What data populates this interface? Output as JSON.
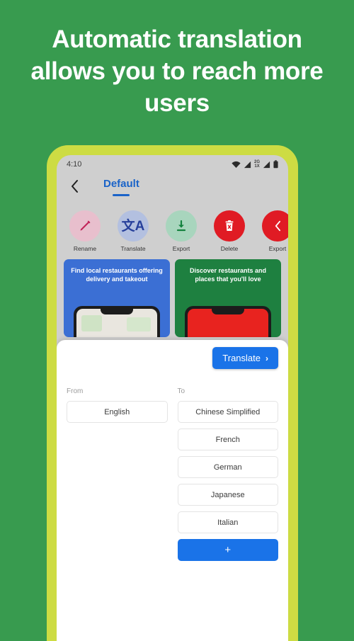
{
  "headline": "Automatic translation allows you to reach more users",
  "colors": {
    "background": "#389b4f",
    "bezel": "#cddc43",
    "screen": "#cfcfcf",
    "accent_blue": "#1a73e8",
    "tab_blue": "#1a63c8",
    "delete_red": "#e01b24"
  },
  "phone": {
    "statusbar": {
      "time": "4:10",
      "data_top": "2G",
      "data_bottom": "1X",
      "icons": [
        "wifi-icon",
        "signal-icon",
        "data-indicator-icon",
        "battery-icon"
      ]
    },
    "appbar": {
      "back_icon": "chevron-left-icon",
      "tab_label": "Default"
    },
    "actions": [
      {
        "label": "Rename",
        "icon": "pencil-icon",
        "circle": "#e8bfcd",
        "fg": "#c2245a"
      },
      {
        "label": "Translate",
        "icon": "translate-icon",
        "circle": "#b3c0e0",
        "fg": "#27409b",
        "glyph": "文A"
      },
      {
        "label": "Export",
        "icon": "download-icon",
        "circle": "#a8d5bd",
        "fg": "#14823f"
      },
      {
        "label": "Delete",
        "icon": "trash-icon",
        "circle": "#e01b24",
        "fg": "#ffffff"
      },
      {
        "label": "Export",
        "icon": "chevron-left-icon",
        "circle": "#e01b24",
        "fg": "#ffffff"
      }
    ],
    "cards": [
      {
        "title": "Find local restaurants offering delivery and takeout",
        "color": "#3b6fd4",
        "mock": "map"
      },
      {
        "title": "Discover restaurants and places that you'll love",
        "color": "#1e8040",
        "mock": "red"
      }
    ]
  },
  "sheet": {
    "translate_button": {
      "label": "Translate",
      "chevron": "›"
    },
    "from": {
      "label": "From",
      "languages": [
        "English"
      ]
    },
    "to": {
      "label": "To",
      "languages": [
        "Chinese Simplified",
        "French",
        "German",
        "Japanese",
        "Italian"
      ],
      "add_label": "+"
    }
  }
}
